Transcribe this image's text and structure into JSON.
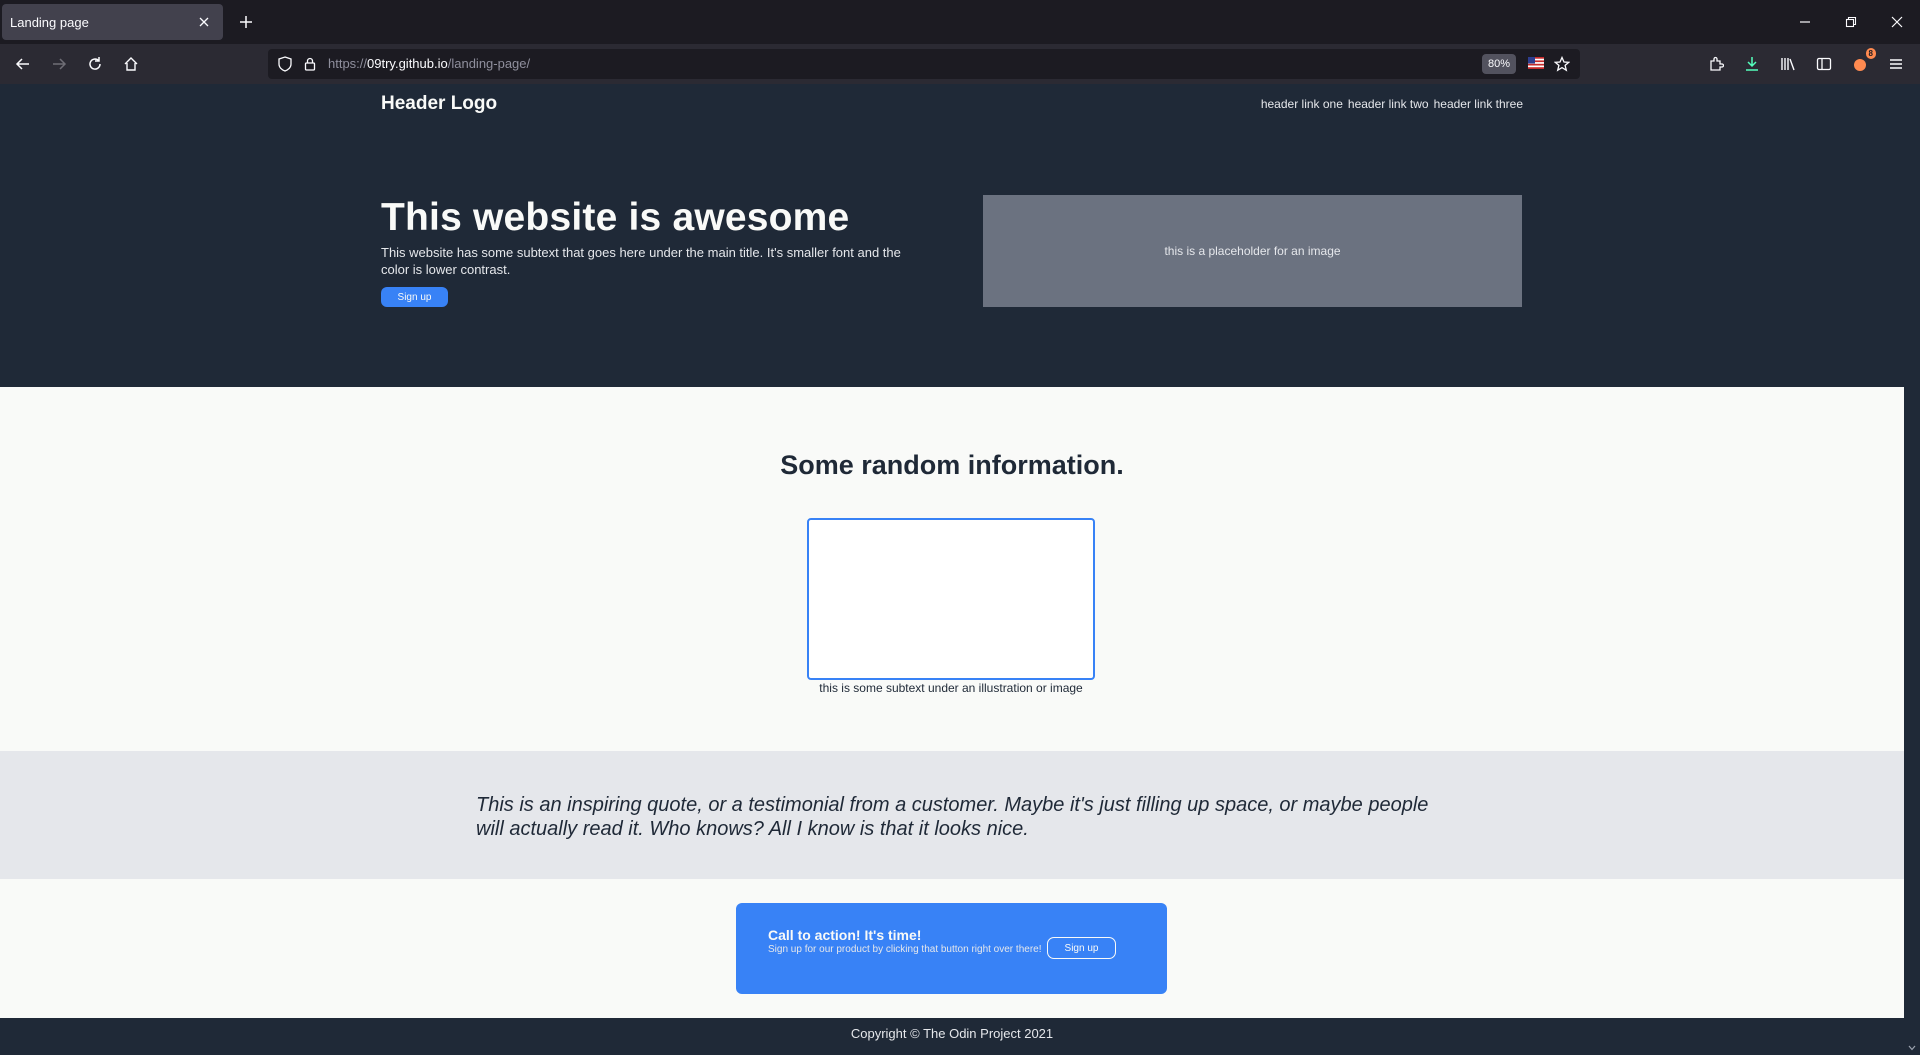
{
  "browser": {
    "tab": {
      "title": "Landing page"
    },
    "url": {
      "scheme": "https://",
      "host": "09try.github.io",
      "path": "/landing-page/"
    },
    "zoom": "80%",
    "extensions_badge": "8",
    "accent_color": "#3882f6"
  },
  "page": {
    "header": {
      "logo": "Header Logo",
      "links": [
        "header link one",
        "header link two",
        "header link three"
      ]
    },
    "hero": {
      "title": "This website is awesome",
      "subtext": "This website has some subtext that goes here under the main title. It's smaller font and the color is lower contrast.",
      "button": "Sign up",
      "image_placeholder": "this is a placeholder for an image"
    },
    "info": {
      "title": "Some random information.",
      "caption": "this is some subtext under an illustration or image"
    },
    "quote": {
      "text": "This is an inspiring quote, or a testimonial from a customer. Maybe it's just filling up space, or maybe people will actually read it. Who knows? All I know is that it looks nice."
    },
    "cta": {
      "title": "Call to action! It's time!",
      "subtext": "Sign up for our product by clicking that button right over there!",
      "button": "Sign up"
    },
    "footer": {
      "text": "Copyright © The Odin Project 2021"
    }
  },
  "colors": {
    "dark": "#1f2937",
    "light": "#f9faf8",
    "gray": "#e5e7eb",
    "blue": "#3882f6"
  }
}
